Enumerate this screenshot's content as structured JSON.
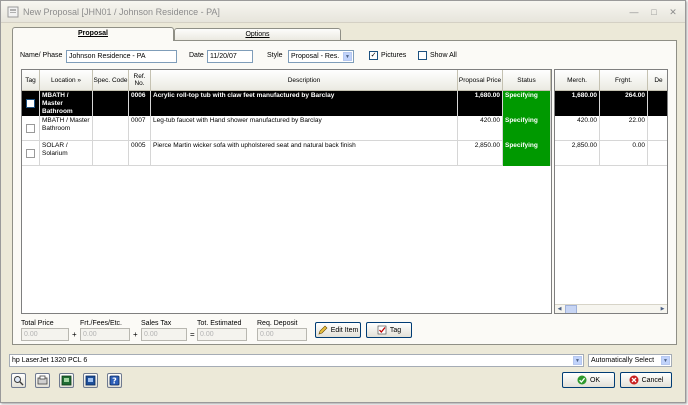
{
  "window": {
    "title": "New Proposal [JHN01 / Johnson Residence - PA]"
  },
  "tabs": [
    {
      "label": "Proposal"
    },
    {
      "label": "Options"
    }
  ],
  "header": {
    "name_phase_label": "Name/ Phase",
    "name_phase_value": "Johnson Residence - PA",
    "date_label": "Date",
    "date_value": "11/20/07",
    "style_label": "Style",
    "style_value": "Proposal - Res.",
    "pictures_label": "Pictures",
    "pictures_checked": true,
    "show_all_label": "Show All",
    "show_all_checked": false
  },
  "grid": {
    "columns": {
      "tag": "Tag",
      "location": "Location »",
      "spec_code": "Spec. Code",
      "ref_no": "Ref. No.",
      "description": "Description",
      "proposal_price": "Proposal Price",
      "status": "Status"
    },
    "right_columns": {
      "merch": "Merch.",
      "frght": "Frght.",
      "de": "De"
    },
    "rows": [
      {
        "location": "MBATH / Master Bathroom",
        "spec_code": "",
        "ref_no": "0006",
        "description": "Acrylic roll-top tub with claw feet manufactured by Barclay",
        "proposal_price": "1,680.00",
        "status": "Specifying",
        "merch": "1,680.00",
        "frght": "264.00",
        "selected": true
      },
      {
        "location": "MBATH / Master Bathroom",
        "spec_code": "",
        "ref_no": "0007",
        "description": "Leg-tub faucet with Hand shower manufactured by Barclay",
        "proposal_price": "420.00",
        "status": "Specifying",
        "merch": "420.00",
        "frght": "22.00",
        "selected": false
      },
      {
        "location": "SOLAR / Solarium",
        "spec_code": "",
        "ref_no": "0005",
        "description": "Pierce Martin wicker sofa with upholstered seat and natural back finish",
        "proposal_price": "2,850.00",
        "status": "Specifying",
        "merch": "2,850.00",
        "frght": "0.00",
        "selected": false
      }
    ]
  },
  "totals": {
    "total_price_label": "Total Price",
    "total_price_value": "0.00",
    "frt_label": "Frt./Fees/Etc.",
    "frt_value": "0.00",
    "sales_tax_label": "Sales Tax",
    "sales_tax_value": "0.00",
    "tot_estimated_label": "Tot. Estimated",
    "tot_estimated_value": "0.00",
    "req_deposit_label": "Req. Deposit",
    "req_deposit_value": "0.00",
    "plus": "+",
    "equals": "="
  },
  "actions": {
    "edit_item": "Edit Item",
    "tag": "Tag"
  },
  "printer": {
    "name": "hp LaserJet 1320 PCL 6",
    "mode": "Automatically Select"
  },
  "footer": {
    "ok": "OK",
    "cancel": "Cancel"
  },
  "colors": {
    "status_green": "#009900",
    "selected_row": "#000000",
    "accent_blue": "#7f9db9"
  },
  "icons": {
    "toolbar": [
      "magnifier-icon",
      "catalog-icon",
      "export-icon",
      "print-preview-icon",
      "help-icon"
    ]
  }
}
